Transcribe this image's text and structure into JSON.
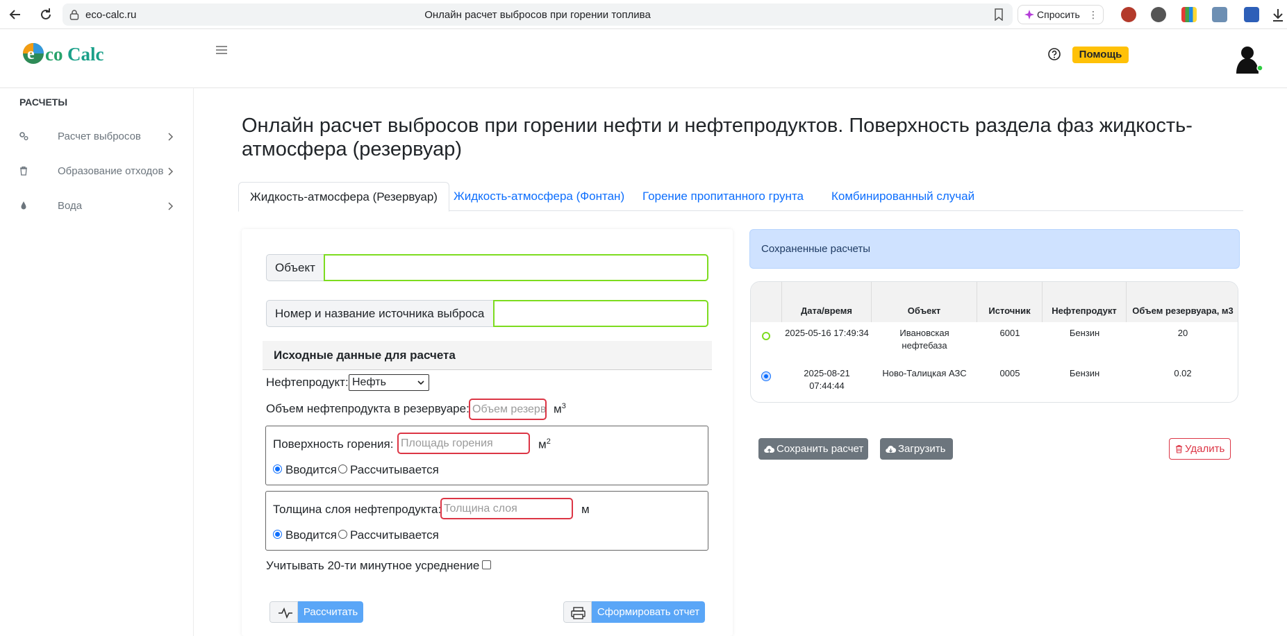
{
  "browser": {
    "url": "eco-calc.ru",
    "tab_title": "Онлайн расчет выбросов при горении топлива",
    "ask_label": "Спросить"
  },
  "header": {
    "logo_text": "ecoCalc",
    "help_label": "Помощь"
  },
  "sidebar": {
    "heading": "РАСЧЕТЫ",
    "items": [
      {
        "label": "Расчет выбросов",
        "icon": "gears-icon"
      },
      {
        "label": "Образование отходов",
        "icon": "trash-icon"
      },
      {
        "label": "Вода",
        "icon": "droplet-icon"
      }
    ]
  },
  "main": {
    "title": "Онлайн расчет выбросов при горении нефти и нефтепродуктов. Поверхность раздела фаз жидкость-атмосфера (резервуар)",
    "tabs": [
      {
        "label": "Жидкость-атмосфера (Резервуар)",
        "active": true
      },
      {
        "label": "Жидкость-атмосфера (Фонтан)",
        "active": false
      },
      {
        "label": "Горение пропитанного грунта",
        "active": false
      },
      {
        "label": "Комбинированный случай",
        "active": false
      }
    ]
  },
  "form": {
    "object_label": "Объект",
    "object_value": "",
    "source_label": "Номер и название источника выброса",
    "source_value": "",
    "section_title": "Исходные данные для расчета",
    "product_label": "Нефтепродукт:",
    "product_selected": "Нефть",
    "volume_label": "Объем нефтепродукта в резервуаре:",
    "volume_placeholder": "Объем резервуара",
    "volume_unit": "м",
    "volume_unit_sup": "3",
    "surface_label": "Поверхность горения:",
    "surface_placeholder": "Площадь горения",
    "surface_unit": "м",
    "surface_unit_sup": "2",
    "surface_mode_input": "Вводится",
    "surface_mode_calc": "Рассчитывается",
    "thickness_label": "Толщина слоя нефтепродукта:",
    "thickness_placeholder": "Толщина слоя",
    "thickness_unit": "м",
    "thickness_mode_input": "Вводится",
    "thickness_mode_calc": "Рассчитывается",
    "averaging_label": "Учитывать 20-ти минутное усреднение",
    "calc_button": "Рассчитать",
    "report_button": "Сформировать отчет"
  },
  "saved": {
    "title": "Сохраненные расчеты",
    "columns": [
      "Дата/время",
      "Объект",
      "Источник",
      "Нефтепродукт",
      "Объем резервуара, м3"
    ],
    "rows": [
      {
        "datetime": "2025-05-16 17:49:34",
        "object": "Ивановская нефтебаза",
        "source": "6001",
        "product": "Бензин",
        "volume": "20",
        "selected": false
      },
      {
        "datetime": "2025-08-21 07:44:44",
        "object": "Ново-Талицкая АЗС",
        "source": "0005",
        "product": "Бензин",
        "volume": "0.02",
        "selected": true
      }
    ],
    "save_button": "Сохранить расчет",
    "load_button": "Загрузить",
    "delete_button": "Удалить"
  },
  "colors": {
    "accent": "#0d6efd",
    "valid_border": "#7ddc1f",
    "invalid_border": "#dc3545",
    "help_button": "#ffc107",
    "primary_button": "#5aa6f7",
    "secondary_button": "#6c757d"
  }
}
